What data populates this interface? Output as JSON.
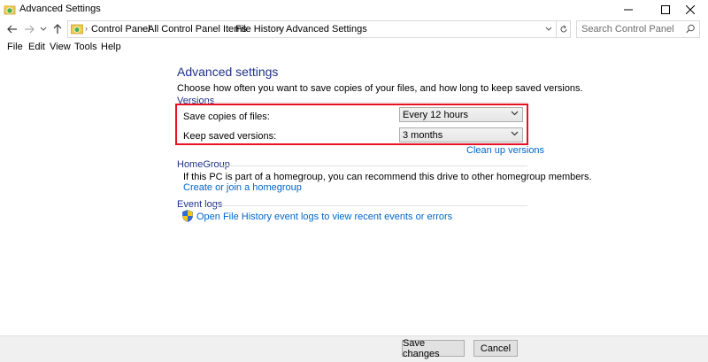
{
  "window": {
    "title": "Advanced Settings"
  },
  "address": {
    "crumbs": [
      "Control Panel",
      "All Control Panel Items",
      "File History",
      "Advanced Settings"
    ],
    "search_placeholder": "Search Control Panel"
  },
  "menu": [
    "File",
    "Edit",
    "View",
    "Tools",
    "Help"
  ],
  "main": {
    "heading": "Advanced settings",
    "description": "Choose how often you want to save copies of your files, and how long to keep saved versions.",
    "versions": {
      "label": "Versions",
      "save_copies_label": "Save copies of files:",
      "save_copies_value": "Every 12 hours",
      "keep_versions_label": "Keep saved versions:",
      "keep_versions_value": "3 months",
      "cleanup_link": "Clean up versions"
    },
    "homegroup": {
      "label": "HomeGroup",
      "text": "If this PC is part of a homegroup, you can recommend this drive to other homegroup members.",
      "link": "Create or join a homegroup"
    },
    "eventlogs": {
      "label": "Event logs",
      "link": "Open File History event logs to view recent events or errors"
    }
  },
  "footer": {
    "save_label": "Save changes",
    "cancel_label": "Cancel"
  },
  "colors": {
    "heading": "#1e3287",
    "link": "#0066cc",
    "highlight": "#e81123"
  }
}
